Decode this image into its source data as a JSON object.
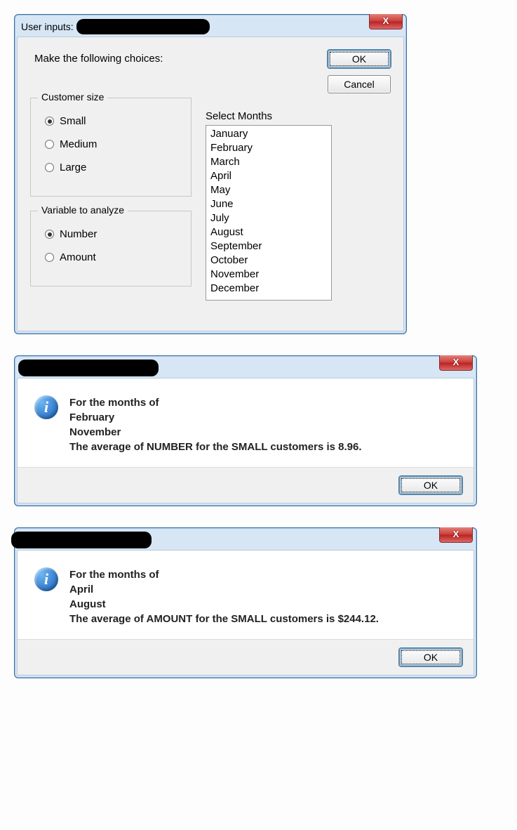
{
  "dialog1": {
    "title_prefix": "User inputs:",
    "prompt": "Make the following choices:",
    "ok_label": "OK",
    "cancel_label": "Cancel",
    "group_size": {
      "legend": "Customer size",
      "options": [
        {
          "label": "Small",
          "selected": true
        },
        {
          "label": "Medium",
          "selected": false
        },
        {
          "label": "Large",
          "selected": false
        }
      ]
    },
    "group_var": {
      "legend": "Variable to analyze",
      "options": [
        {
          "label": "Number",
          "selected": true
        },
        {
          "label": "Amount",
          "selected": false
        }
      ]
    },
    "months_label": "Select Months",
    "months": [
      "January",
      "February",
      "March",
      "April",
      "May",
      "June",
      "July",
      "August",
      "September",
      "October",
      "November",
      "December"
    ]
  },
  "dialog2": {
    "lines": [
      "For the months of",
      "February",
      "November",
      "The average of NUMBER for the SMALL customers is 8.96."
    ],
    "ok_label": "OK"
  },
  "dialog3": {
    "lines": [
      "For the months of",
      "April",
      "August",
      "The average of AMOUNT for the SMALL customers is $244.12."
    ],
    "ok_label": "OK"
  },
  "icons": {
    "close_glyph": "X",
    "info_glyph": "i"
  }
}
